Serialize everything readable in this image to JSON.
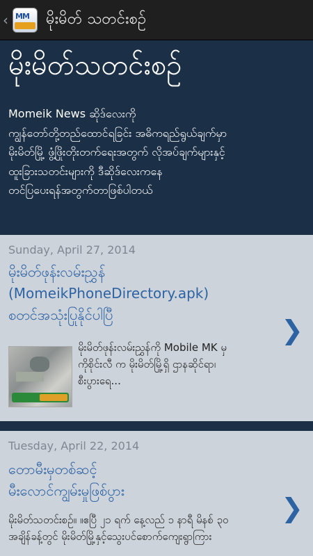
{
  "actionbar": {
    "app_icon_text": "MM",
    "title": "မိုးမိတ် သတင်းစဉ်"
  },
  "header": {
    "title": "မိုးမိတ်သတင်းစဉ်",
    "description_lines": [
      "Momeik News ဆိုဒ်လေးကို",
      "ကျွန်တော်တို့တည်ထောင်ရခြင်း အဓိကရည်ရွယ်ချက်မှာ",
      "မိုးမိတ်မြို့ ဖွံ့ဖြိုးတိုးတက်ရေးအတွက် လိုအပ်ချက်များနှင့်",
      "ထူးခြားသတင်းများကို ဒီဆိုဒ်လေးကနေ",
      "တင်ပြပေးရန်အတွက်တာဖြစ်ပါတယ်"
    ]
  },
  "posts": [
    {
      "date": "Sunday, April 27, 2014",
      "title_lines": [
        "မိုးမိတ်ဖုန်းလမ်းညွှန်",
        "(MomeikPhoneDirectory.apk)",
        "စတင်အသုံးပြုနိုင်ပါပြီ"
      ],
      "excerpt_lines": [
        "မိုးမိတ်ဖုန်းလမ်းညွှန်ကို Mobile MK မှ",
        "ကိုစိုင်းလီ က မိုးမိတ်မြို့ရှိ ဌာနဆိုင်ရာ၊",
        "စီးပွားရေ..."
      ]
    },
    {
      "date": "Tuesday, April 22, 2014",
      "title_lines": [
        "တောမီးမှတစ်ဆင့်",
        "မီးလောင်ကျွမ်းမှုဖြစ်ပွား"
      ],
      "excerpt_lines": [
        "မိုးမိတ်သတင်းစဉ်။    ။ဧပြီ ၂၁ ရက် နေ့လည် ၁ နာရီ မိနစ် ၃၀",
        "အချိန်ခန့်တွင် မိုးမိတ်မြို့နှင့်သွေးပင်စောက်ကျေးရွာကြား"
      ]
    }
  ]
}
